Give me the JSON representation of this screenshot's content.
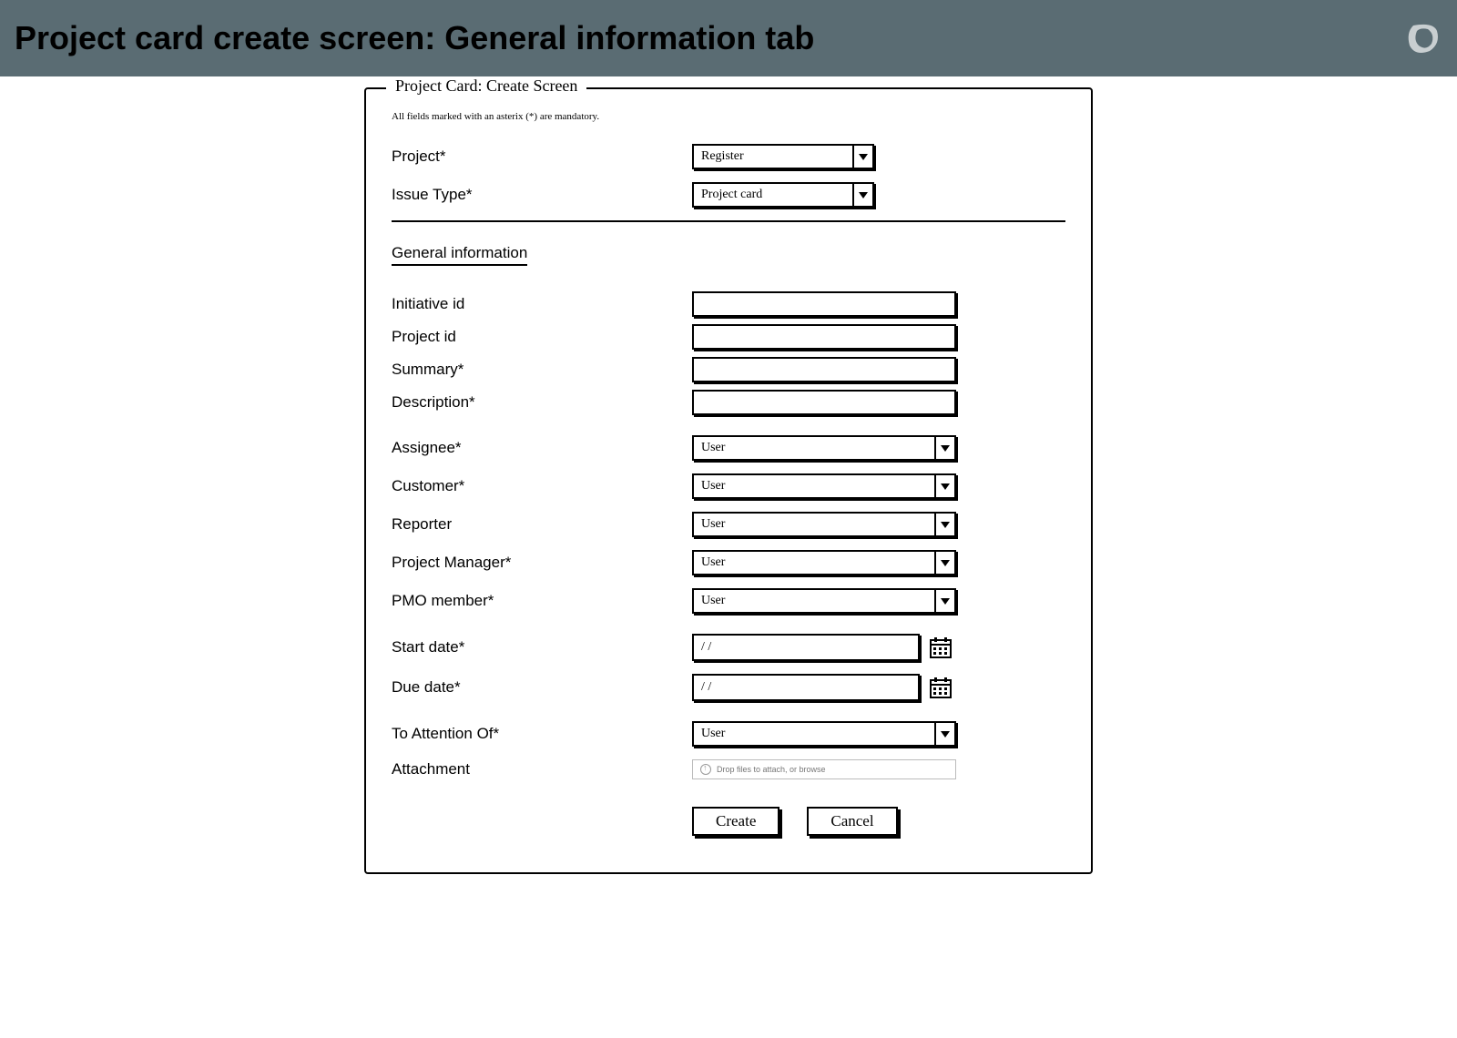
{
  "header": {
    "title": "Project card create screen: General information tab"
  },
  "frame": {
    "legend": "Project Card: Create Screen",
    "note": "All fields marked with an asterix (*) are mandatory."
  },
  "topFields": {
    "project": {
      "label": "Project*",
      "value": "Register"
    },
    "issueType": {
      "label": "Issue Type*",
      "value": "Project card"
    }
  },
  "tab": {
    "label": "General information"
  },
  "fields": {
    "initiativeId": {
      "label": "Initiative id",
      "value": ""
    },
    "projectId": {
      "label": "Project id",
      "value": ""
    },
    "summary": {
      "label": "Summary*",
      "value": ""
    },
    "description": {
      "label": "Description*",
      "value": ""
    },
    "assignee": {
      "label": "Assignee*",
      "value": "User"
    },
    "customer": {
      "label": "Customer*",
      "value": "User"
    },
    "reporter": {
      "label": "Reporter",
      "value": "User"
    },
    "projectManager": {
      "label": "Project Manager*",
      "value": "User"
    },
    "pmoMember": {
      "label": "PMO member*",
      "value": "User"
    },
    "startDate": {
      "label": "Start date*",
      "value": "/ /"
    },
    "dueDate": {
      "label": "Due date*",
      "value": "/ /"
    },
    "toAttention": {
      "label": "To Attention Of*",
      "value": "User"
    },
    "attachment": {
      "label": "Attachment",
      "hint": "Drop files to attach, or browse"
    }
  },
  "buttons": {
    "create": "Create",
    "cancel": "Cancel"
  }
}
